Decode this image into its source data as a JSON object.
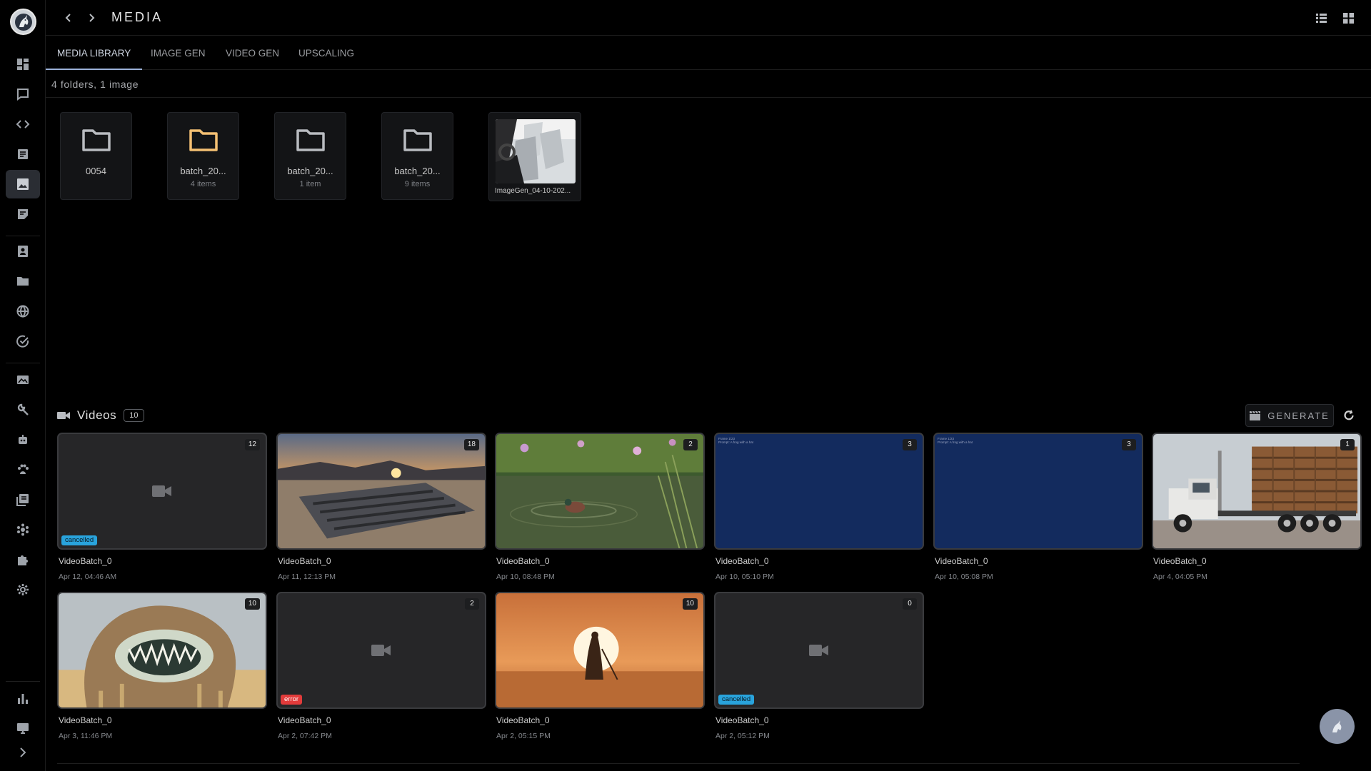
{
  "header": {
    "title": "MEDIA"
  },
  "tabs": [
    {
      "label": "MEDIA LIBRARY"
    },
    {
      "label": "IMAGE GEN"
    },
    {
      "label": "VIDEO GEN"
    },
    {
      "label": "UPSCALING"
    }
  ],
  "summary": "4 folders, 1 image",
  "folders": [
    {
      "name": "0054",
      "count": "",
      "color": "#b9bcc1"
    },
    {
      "name": "batch_20...",
      "count": "4 items",
      "color": "#f4c073"
    },
    {
      "name": "batch_20...",
      "count": "1 item",
      "color": "#b9bcc1"
    },
    {
      "name": "batch_20...",
      "count": "9 items",
      "color": "#b9bcc1"
    }
  ],
  "image": {
    "name": "ImageGen_04-10-202..."
  },
  "videos": {
    "title": "Videos",
    "count": "10",
    "generate_label": "GENERATE",
    "items": [
      {
        "name": "VideoBatch_0",
        "date": "Apr 12, 04:46 AM",
        "count": "12",
        "status": "cancelled",
        "thumb": "empty"
      },
      {
        "name": "VideoBatch_0",
        "date": "Apr 11, 12:13 PM",
        "count": "18",
        "status": "",
        "thumb": "desert"
      },
      {
        "name": "VideoBatch_0",
        "date": "Apr 10, 08:48 PM",
        "count": "2",
        "status": "",
        "thumb": "pond"
      },
      {
        "name": "VideoBatch_0",
        "date": "Apr 10, 05:10 PM",
        "count": "3",
        "status": "",
        "thumb": "navy",
        "overlay1": "Frame 1/23",
        "overlay2": "Prompt: A frog with a hat"
      },
      {
        "name": "VideoBatch_0",
        "date": "Apr 10, 05:08 PM",
        "count": "3",
        "status": "",
        "thumb": "navy",
        "overlay1": "Frame 1/23",
        "overlay2": "Prompt: A frog with a hat"
      },
      {
        "name": "VideoBatch_0",
        "date": "Apr 4, 04:05 PM",
        "count": "1",
        "status": "",
        "thumb": "truck"
      },
      {
        "name": "VideoBatch_0",
        "date": "Apr 3, 11:46 PM",
        "count": "10",
        "status": "",
        "thumb": "worm"
      },
      {
        "name": "VideoBatch_0",
        "date": "Apr 2, 07:42 PM",
        "count": "2",
        "status": "error",
        "thumb": "empty"
      },
      {
        "name": "VideoBatch_0",
        "date": "Apr 2, 05:15 PM",
        "count": "10",
        "status": "",
        "thumb": "sunset"
      },
      {
        "name": "VideoBatch_0",
        "date": "Apr 2, 05:12 PM",
        "count": "0",
        "status": "cancelled",
        "thumb": "empty"
      }
    ]
  },
  "sidebar": {
    "items": [
      {
        "icon": "dashboard-icon"
      },
      {
        "icon": "chat-icon"
      },
      {
        "icon": "code-icon"
      },
      {
        "icon": "document-icon"
      },
      {
        "icon": "image-icon",
        "active": true
      },
      {
        "icon": "notes-icon"
      },
      {
        "icon": "contact-icon"
      },
      {
        "icon": "folder-icon"
      },
      {
        "icon": "globe-icon"
      },
      {
        "icon": "check-circle-icon"
      },
      {
        "icon": "gallery-icon"
      },
      {
        "icon": "wrench-icon"
      },
      {
        "icon": "robot-icon"
      },
      {
        "icon": "paw-icon"
      },
      {
        "icon": "library-icon"
      },
      {
        "icon": "hub-icon"
      },
      {
        "icon": "puzzle-icon"
      },
      {
        "icon": "gear-icon"
      },
      {
        "icon": "bar-chart-icon"
      },
      {
        "icon": "monitor-icon"
      },
      {
        "icon": "chevron-right-icon"
      }
    ]
  }
}
